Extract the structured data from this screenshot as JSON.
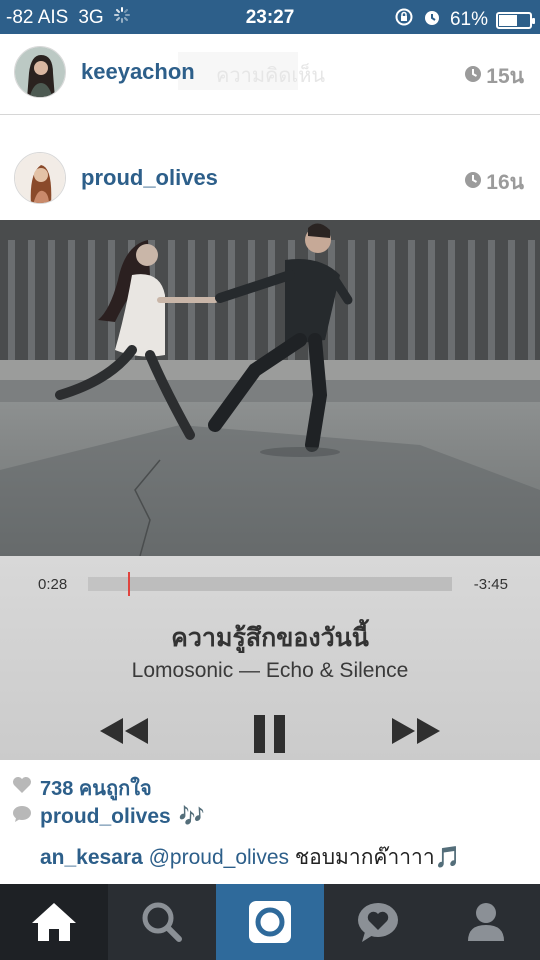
{
  "status_bar": {
    "carrier": "-82 AIS",
    "network": "3G",
    "time": "23:27",
    "battery": "61%",
    "battery_level": 0.61
  },
  "feed": [
    {
      "username": "keeyachon",
      "ghost_text": "ความคิดเห็น",
      "time": "15น"
    },
    {
      "username": "proud_olives",
      "time": "16น"
    }
  ],
  "player": {
    "elapsed": "0:28",
    "remaining": "-3:45",
    "progress": 0.11,
    "title": "ความรู้สึกของวันนี้",
    "artist": "Lomosonic — Echo & Silence"
  },
  "post": {
    "likes": "738 คนถูกใจ",
    "caption_user": "proud_olives",
    "caption_text": "🎶",
    "comment_user": "an_kesara",
    "comment_mention": "@proud_olives",
    "comment_text": "ชอบมากค๊าาาา🎵"
  },
  "tabs": [
    "home",
    "explore",
    "camera",
    "activity",
    "profile"
  ],
  "colors": {
    "accent": "#2d5f8a",
    "tabbar": "#2a2e33",
    "camera_tab": "#2f6a9b",
    "scrubber": "#e0443e"
  }
}
